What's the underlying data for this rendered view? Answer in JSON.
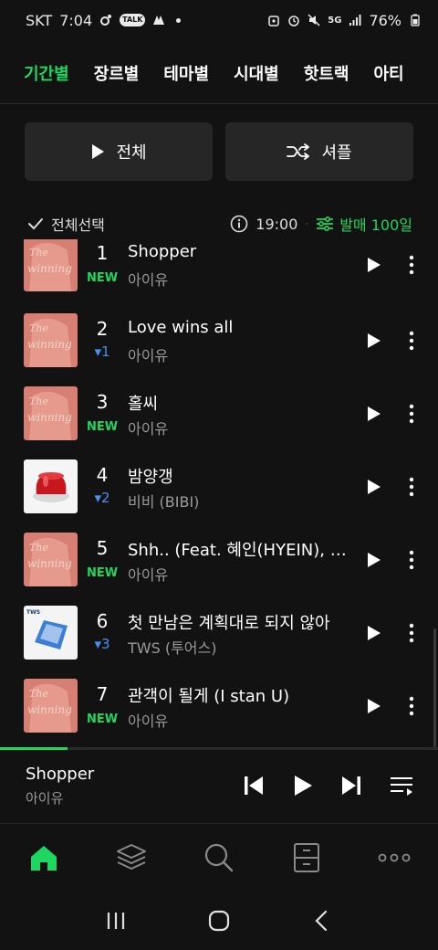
{
  "status_bar": {
    "carrier": "SKT",
    "time": "7:04",
    "talk_label": "TALK",
    "network": "5G",
    "battery": "76%"
  },
  "tabs": [
    {
      "label": "기간별",
      "active": true
    },
    {
      "label": "장르별",
      "active": false
    },
    {
      "label": "테마별",
      "active": false
    },
    {
      "label": "시대별",
      "active": false
    },
    {
      "label": "핫트랙",
      "active": false
    },
    {
      "label": "아티",
      "active": false
    }
  ],
  "actions": {
    "play_all_label": "전체",
    "shuffle_label": "셔플"
  },
  "toolbar": {
    "select_all_label": "전체선택",
    "update_time": "19:00",
    "period_label": "발매 100일"
  },
  "songs": [
    {
      "rank": "1",
      "change": "NEW",
      "change_type": "new",
      "title": "Shopper",
      "artist": "아이유",
      "cover": "iu"
    },
    {
      "rank": "2",
      "change": "1",
      "change_type": "down",
      "title": "Love wins all",
      "artist": "아이유",
      "cover": "iu"
    },
    {
      "rank": "3",
      "change": "NEW",
      "change_type": "new",
      "title": "홀씨",
      "artist": "아이유",
      "cover": "iu"
    },
    {
      "rank": "4",
      "change": "2",
      "change_type": "down",
      "title": "밤양갱",
      "artist": "비비 (BIBI)",
      "cover": "bibi"
    },
    {
      "rank": "5",
      "change": "NEW",
      "change_type": "new",
      "title": "Shh.. (Feat. 혜인(HYEIN), 조원선 of 롤러코스터)",
      "artist": "아이유",
      "cover": "iu"
    },
    {
      "rank": "6",
      "change": "3",
      "change_type": "down",
      "title": "첫 만남은 계획대로 되지 않아",
      "artist": "TWS (투어스)",
      "cover": "tws"
    },
    {
      "rank": "7",
      "change": "NEW",
      "change_type": "new",
      "title": "관객이 될게 (I stan U)",
      "artist": "아이유",
      "cover": "iu"
    }
  ],
  "now_playing": {
    "title": "Shopper",
    "artist": "아이유",
    "progress": 0.155
  },
  "colors": {
    "accent": "#1ed760",
    "rank_down": "#4b8ff0",
    "background": "#121212"
  },
  "nav_icons": [
    "home-icon",
    "library-icon",
    "search-icon",
    "storage-icon",
    "more-icon"
  ]
}
